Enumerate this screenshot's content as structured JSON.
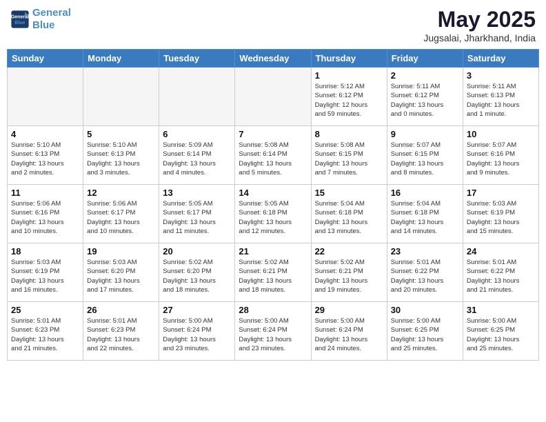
{
  "logo": {
    "line1": "General",
    "line2": "Blue"
  },
  "title": "May 2025",
  "location": "Jugsalai, Jharkhand, India",
  "weekdays": [
    "Sunday",
    "Monday",
    "Tuesday",
    "Wednesday",
    "Thursday",
    "Friday",
    "Saturday"
  ],
  "weeks": [
    [
      {
        "day": "",
        "info": ""
      },
      {
        "day": "",
        "info": ""
      },
      {
        "day": "",
        "info": ""
      },
      {
        "day": "",
        "info": ""
      },
      {
        "day": "1",
        "info": "Sunrise: 5:12 AM\nSunset: 6:12 PM\nDaylight: 12 hours\nand 59 minutes."
      },
      {
        "day": "2",
        "info": "Sunrise: 5:11 AM\nSunset: 6:12 PM\nDaylight: 13 hours\nand 0 minutes."
      },
      {
        "day": "3",
        "info": "Sunrise: 5:11 AM\nSunset: 6:13 PM\nDaylight: 13 hours\nand 1 minute."
      }
    ],
    [
      {
        "day": "4",
        "info": "Sunrise: 5:10 AM\nSunset: 6:13 PM\nDaylight: 13 hours\nand 2 minutes."
      },
      {
        "day": "5",
        "info": "Sunrise: 5:10 AM\nSunset: 6:13 PM\nDaylight: 13 hours\nand 3 minutes."
      },
      {
        "day": "6",
        "info": "Sunrise: 5:09 AM\nSunset: 6:14 PM\nDaylight: 13 hours\nand 4 minutes."
      },
      {
        "day": "7",
        "info": "Sunrise: 5:08 AM\nSunset: 6:14 PM\nDaylight: 13 hours\nand 5 minutes."
      },
      {
        "day": "8",
        "info": "Sunrise: 5:08 AM\nSunset: 6:15 PM\nDaylight: 13 hours\nand 7 minutes."
      },
      {
        "day": "9",
        "info": "Sunrise: 5:07 AM\nSunset: 6:15 PM\nDaylight: 13 hours\nand 8 minutes."
      },
      {
        "day": "10",
        "info": "Sunrise: 5:07 AM\nSunset: 6:16 PM\nDaylight: 13 hours\nand 9 minutes."
      }
    ],
    [
      {
        "day": "11",
        "info": "Sunrise: 5:06 AM\nSunset: 6:16 PM\nDaylight: 13 hours\nand 10 minutes."
      },
      {
        "day": "12",
        "info": "Sunrise: 5:06 AM\nSunset: 6:17 PM\nDaylight: 13 hours\nand 10 minutes."
      },
      {
        "day": "13",
        "info": "Sunrise: 5:05 AM\nSunset: 6:17 PM\nDaylight: 13 hours\nand 11 minutes."
      },
      {
        "day": "14",
        "info": "Sunrise: 5:05 AM\nSunset: 6:18 PM\nDaylight: 13 hours\nand 12 minutes."
      },
      {
        "day": "15",
        "info": "Sunrise: 5:04 AM\nSunset: 6:18 PM\nDaylight: 13 hours\nand 13 minutes."
      },
      {
        "day": "16",
        "info": "Sunrise: 5:04 AM\nSunset: 6:18 PM\nDaylight: 13 hours\nand 14 minutes."
      },
      {
        "day": "17",
        "info": "Sunrise: 5:03 AM\nSunset: 6:19 PM\nDaylight: 13 hours\nand 15 minutes."
      }
    ],
    [
      {
        "day": "18",
        "info": "Sunrise: 5:03 AM\nSunset: 6:19 PM\nDaylight: 13 hours\nand 16 minutes."
      },
      {
        "day": "19",
        "info": "Sunrise: 5:03 AM\nSunset: 6:20 PM\nDaylight: 13 hours\nand 17 minutes."
      },
      {
        "day": "20",
        "info": "Sunrise: 5:02 AM\nSunset: 6:20 PM\nDaylight: 13 hours\nand 18 minutes."
      },
      {
        "day": "21",
        "info": "Sunrise: 5:02 AM\nSunset: 6:21 PM\nDaylight: 13 hours\nand 18 minutes."
      },
      {
        "day": "22",
        "info": "Sunrise: 5:02 AM\nSunset: 6:21 PM\nDaylight: 13 hours\nand 19 minutes."
      },
      {
        "day": "23",
        "info": "Sunrise: 5:01 AM\nSunset: 6:22 PM\nDaylight: 13 hours\nand 20 minutes."
      },
      {
        "day": "24",
        "info": "Sunrise: 5:01 AM\nSunset: 6:22 PM\nDaylight: 13 hours\nand 21 minutes."
      }
    ],
    [
      {
        "day": "25",
        "info": "Sunrise: 5:01 AM\nSunset: 6:23 PM\nDaylight: 13 hours\nand 21 minutes."
      },
      {
        "day": "26",
        "info": "Sunrise: 5:01 AM\nSunset: 6:23 PM\nDaylight: 13 hours\nand 22 minutes."
      },
      {
        "day": "27",
        "info": "Sunrise: 5:00 AM\nSunset: 6:24 PM\nDaylight: 13 hours\nand 23 minutes."
      },
      {
        "day": "28",
        "info": "Sunrise: 5:00 AM\nSunset: 6:24 PM\nDaylight: 13 hours\nand 23 minutes."
      },
      {
        "day": "29",
        "info": "Sunrise: 5:00 AM\nSunset: 6:24 PM\nDaylight: 13 hours\nand 24 minutes."
      },
      {
        "day": "30",
        "info": "Sunrise: 5:00 AM\nSunset: 6:25 PM\nDaylight: 13 hours\nand 25 minutes."
      },
      {
        "day": "31",
        "info": "Sunrise: 5:00 AM\nSunset: 6:25 PM\nDaylight: 13 hours\nand 25 minutes."
      }
    ]
  ]
}
